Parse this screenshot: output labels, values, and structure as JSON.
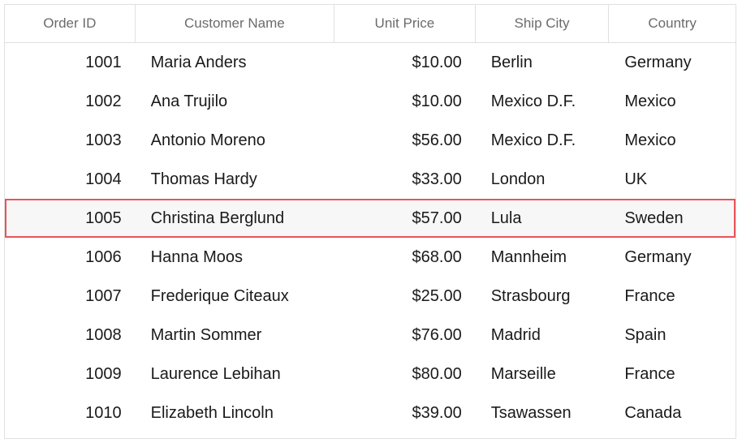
{
  "columns": {
    "order_id": "Order ID",
    "customer_name": "Customer Name",
    "unit_price": "Unit Price",
    "ship_city": "Ship City",
    "country": "Country"
  },
  "selected_row_index": 4,
  "colors": {
    "selection_border": "#e8545a",
    "selection_background": "#f7f7f7",
    "grid_line": "#e0e0e0",
    "header_text": "#6b6b6b"
  },
  "rows": [
    {
      "order_id": "1001",
      "customer_name": "Maria Anders",
      "unit_price": "$10.00",
      "ship_city": "Berlin",
      "country": "Germany"
    },
    {
      "order_id": "1002",
      "customer_name": "Ana Trujilo",
      "unit_price": "$10.00",
      "ship_city": "Mexico D.F.",
      "country": "Mexico"
    },
    {
      "order_id": "1003",
      "customer_name": "Antonio Moreno",
      "unit_price": "$56.00",
      "ship_city": "Mexico D.F.",
      "country": "Mexico"
    },
    {
      "order_id": "1004",
      "customer_name": "Thomas Hardy",
      "unit_price": "$33.00",
      "ship_city": "London",
      "country": "UK"
    },
    {
      "order_id": "1005",
      "customer_name": "Christina Berglund",
      "unit_price": "$57.00",
      "ship_city": "Lula",
      "country": "Sweden"
    },
    {
      "order_id": "1006",
      "customer_name": "Hanna Moos",
      "unit_price": "$68.00",
      "ship_city": "Mannheim",
      "country": "Germany"
    },
    {
      "order_id": "1007",
      "customer_name": "Frederique Citeaux",
      "unit_price": "$25.00",
      "ship_city": "Strasbourg",
      "country": "France"
    },
    {
      "order_id": "1008",
      "customer_name": "Martin Sommer",
      "unit_price": "$76.00",
      "ship_city": "Madrid",
      "country": "Spain"
    },
    {
      "order_id": "1009",
      "customer_name": "Laurence Lebihan",
      "unit_price": "$80.00",
      "ship_city": "Marseille",
      "country": "France"
    },
    {
      "order_id": "1010",
      "customer_name": "Elizabeth Lincoln",
      "unit_price": "$39.00",
      "ship_city": "Tsawassen",
      "country": "Canada"
    }
  ]
}
